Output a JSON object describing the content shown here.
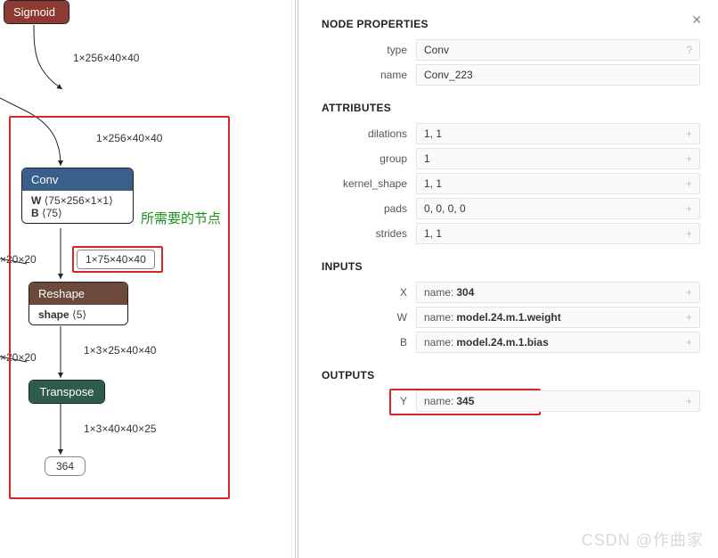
{
  "panel": {
    "title": "NODE PROPERTIES",
    "section_attributes": "ATTRIBUTES",
    "section_inputs": "INPUTS",
    "section_outputs": "OUTPUTS",
    "close": "✕",
    "props": {
      "type_label": "type",
      "type_value": "Conv",
      "type_hint": "?",
      "name_label": "name",
      "name_value": "Conv_223"
    },
    "attributes": {
      "dilations_label": "dilations",
      "dilations_value": "1, 1",
      "group_label": "group",
      "group_value": "1",
      "kernel_shape_label": "kernel_shape",
      "kernel_shape_value": "1, 1",
      "pads_label": "pads",
      "pads_value": "0, 0, 0, 0",
      "strides_label": "strides",
      "strides_value": "1, 1",
      "plus": "+"
    },
    "inputs": {
      "X_label": "X",
      "X_prefix": "name: ",
      "X_value": "304",
      "W_label": "W",
      "W_prefix": "name: ",
      "W_value": "model.24.m.1.weight",
      "B_label": "B",
      "B_prefix": "name: ",
      "B_value": "model.24.m.1.bias"
    },
    "outputs": {
      "Y_label": "Y",
      "Y_prefix": "name: ",
      "Y_value": "345"
    }
  },
  "graph": {
    "sigmoid": {
      "title": "Sigmoid"
    },
    "sigmoid_out_dim": "1×256×40×40",
    "conv_in_dim": "1×256×40×40",
    "conv": {
      "title": "Conv",
      "w_label": "W",
      "w_shape": "⟨75×256×1×1⟩",
      "b_label": "B",
      "b_shape": "⟨75⟩"
    },
    "annotation_green": "所需要的节点",
    "conv_out_dim": "1×75×40×40",
    "reshape": {
      "title": "Reshape",
      "shape_label": "shape",
      "shape_val": "⟨5⟩"
    },
    "reshape_out_dim": "1×3×25×40×40",
    "transpose": {
      "title": "Transpose"
    },
    "transpose_out_dim": "1×3×40×40×25",
    "final_node": "364",
    "edge_20_20_a": "×20×20",
    "edge_20_20_b": "×20×20"
  },
  "icons": {
    "close": "close-icon"
  },
  "watermark": "CSDN @作曲家"
}
